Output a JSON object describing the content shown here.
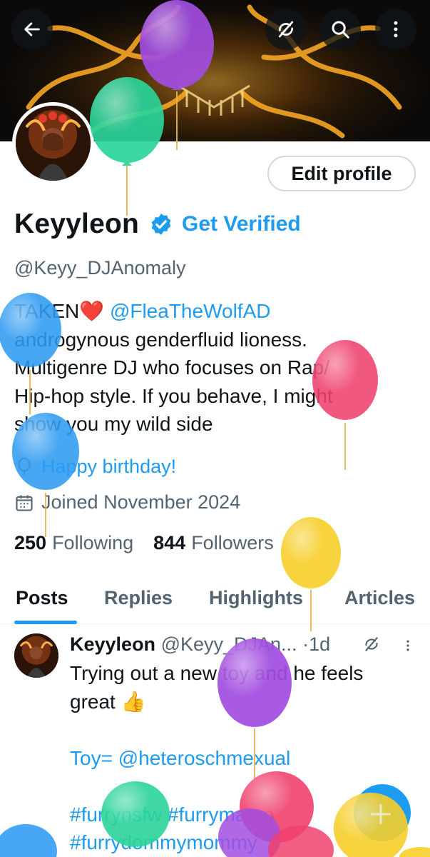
{
  "header": {
    "back_icon": "arrow-left-icon",
    "sync_icon": "sync-off-icon",
    "search_icon": "search-icon",
    "more_icon": "more-vertical-icon"
  },
  "profile": {
    "edit_label": "Edit profile",
    "name": "Keyyleon",
    "get_verified": "Get Verified",
    "handle": "@Keyy_DJAnomaly",
    "bio_lines": [
      {
        "pre": "TAKEN",
        "emoji": "❤️",
        "mention": "@FleaTheWolfAD"
      },
      {
        "text": "androgynous genderfluid lioness."
      },
      {
        "text": "Multigenre DJ who focuses on Rap/"
      },
      {
        "text": "Hip-hop style. If you behave, I might"
      },
      {
        "text": "show you my wild side"
      }
    ],
    "birthday": "Happy birthday!",
    "joined": "Joined November 2024",
    "following_count": "250",
    "following_label": "Following",
    "followers_count": "844",
    "followers_label": "Followers"
  },
  "tabs": [
    "Posts",
    "Replies",
    "Highlights",
    "Articles"
  ],
  "post": {
    "name": "Keyyleon",
    "handle": "@Keyy_DJAn...",
    "dot": "·",
    "time": "1d",
    "lines": [
      "Trying out a new toy and he feels",
      "great 👍",
      "",
      "Toy= @heteroschmexual",
      "",
      "#furrynsfw #furrymacro",
      "#furrydommymommy"
    ]
  },
  "colors": {
    "accent": "#1d9bf0",
    "secondary_text": "#536471",
    "balloon_purple": "#a24de0",
    "balloon_green": "#2bd49a",
    "balloon_blue": "#2e9bf2",
    "balloon_pink": "#f0416e",
    "balloon_yellow": "#f7cf2a"
  }
}
